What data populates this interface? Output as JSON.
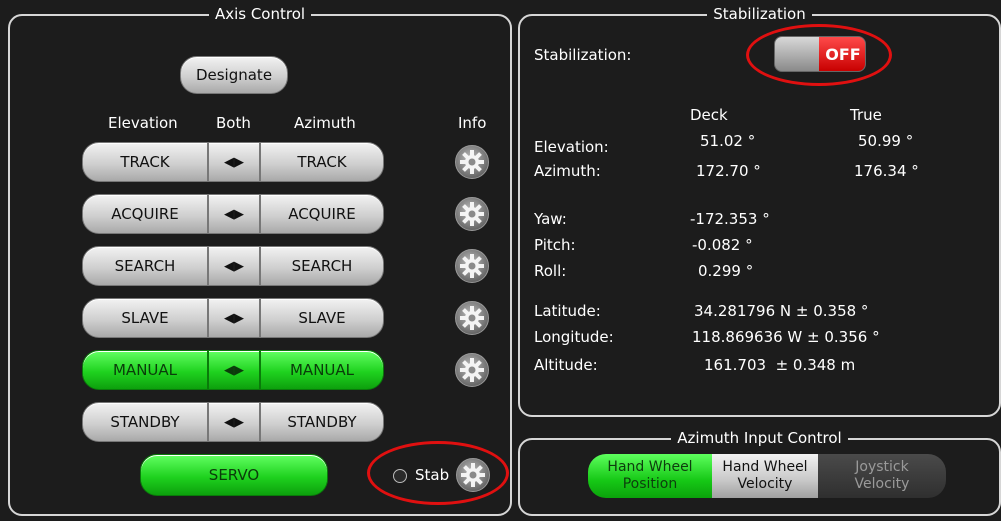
{
  "axis_control": {
    "title": "Axis Control",
    "designate_label": "Designate",
    "headers": {
      "elevation": "Elevation",
      "both": "Both",
      "azimuth": "Azimuth",
      "info": "Info"
    },
    "rows": [
      {
        "elevation": "TRACK",
        "azimuth": "TRACK",
        "active": false
      },
      {
        "elevation": "ACQUIRE",
        "azimuth": "ACQUIRE",
        "active": false
      },
      {
        "elevation": "SEARCH",
        "azimuth": "SEARCH",
        "active": false
      },
      {
        "elevation": "SLAVE",
        "azimuth": "SLAVE",
        "active": false
      },
      {
        "elevation": "MANUAL",
        "azimuth": "MANUAL",
        "active": true
      },
      {
        "elevation": "STANDBY",
        "azimuth": "STANDBY",
        "active": false
      }
    ],
    "both_symbol": "◀▶",
    "servo_label": "SERVO",
    "stab_label": "Stab"
  },
  "stabilization": {
    "title": "Stabilization",
    "label": "Stabilization:",
    "toggle_state": "OFF",
    "col_deck": "Deck",
    "col_true": "True",
    "elevation": {
      "label": "Elevation:",
      "deck": "51.02 °",
      "true": "50.99 °"
    },
    "azimuth": {
      "label": "Azimuth:",
      "deck": "172.70 °",
      "true": "176.34 °"
    },
    "yaw": {
      "label": "Yaw:",
      "value": "-172.353 °"
    },
    "pitch": {
      "label": "Pitch:",
      "value": "-0.082 °"
    },
    "roll": {
      "label": "Roll:",
      "value": "0.299 °"
    },
    "latitude": {
      "label": "Latitude:",
      "value": "34.281796 N ± 0.358 °"
    },
    "longitude": {
      "label": "Longitude:",
      "value": "118.869636 W ± 0.356 °"
    },
    "altitude": {
      "label": "Altitude:",
      "value": "161.703  ± 0.348 m"
    }
  },
  "azimuth_input": {
    "title": "Azimuth Input Control",
    "options": [
      {
        "line1": "Hand Wheel",
        "line2": "Position",
        "state": "active"
      },
      {
        "line1": "Hand Wheel",
        "line2": "Velocity",
        "state": "normal"
      },
      {
        "line1": "Joystick",
        "line2": "Velocity",
        "state": "disabled"
      }
    ]
  },
  "colors": {
    "active": "#1fd21f",
    "off": "#d40000",
    "highlight_ring": "#e01010"
  }
}
